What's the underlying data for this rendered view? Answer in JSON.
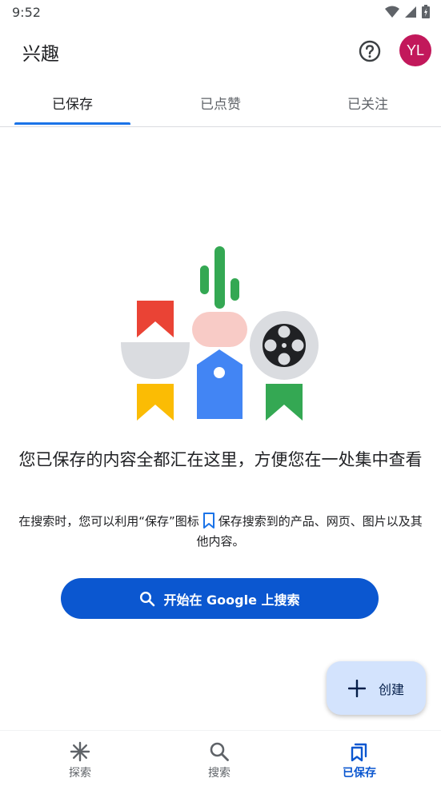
{
  "status_bar": {
    "time": "9:52"
  },
  "app_bar": {
    "title": "兴趣",
    "avatar_initials": "YL",
    "avatar_color": "#c2185b"
  },
  "tabs": [
    {
      "label": "已保存",
      "active": true
    },
    {
      "label": "已点赞",
      "active": false
    },
    {
      "label": "已关注",
      "active": false
    }
  ],
  "empty_state": {
    "title": "您已保存的内容全都汇在这里，方便您在一处集中查看",
    "desc_before": "在搜索时，您可以利用“保存”图标",
    "desc_after": "保存搜索到的产品、网页、图片以及其他内容。",
    "icon": "bookmark-icon"
  },
  "search_button": {
    "label": "开始在 Google 上搜索",
    "icon": "search-icon"
  },
  "fab": {
    "label": "创建",
    "icon": "plus-icon"
  },
  "bottom_nav": [
    {
      "label": "探索",
      "icon": "asterisk-icon",
      "active": false
    },
    {
      "label": "搜索",
      "icon": "search-icon",
      "active": false
    },
    {
      "label": "已保存",
      "icon": "saved-collection-icon",
      "active": true
    }
  ],
  "colors": {
    "accent": "#0b57d0",
    "tab_indicator": "#1a73e8",
    "fab_bg": "#d3e3fd"
  }
}
